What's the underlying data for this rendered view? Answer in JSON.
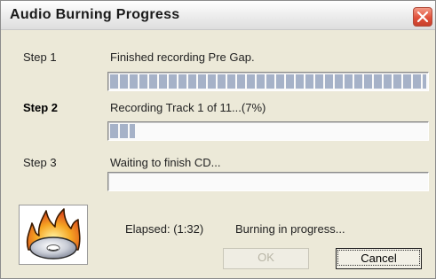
{
  "window": {
    "title": "Audio Burning Progress"
  },
  "steps": [
    {
      "label": "Step 1",
      "status": "Finished recording Pre Gap.",
      "progress": 1.0
    },
    {
      "label": "Step 2",
      "status": "Recording Track 1 of 11...(7%)",
      "progress": 0.08
    },
    {
      "label": "Step 3",
      "status": "Waiting to finish CD...",
      "progress": 0.0
    }
  ],
  "footer": {
    "elapsed": "Elapsed: (1:32)",
    "message": "Burning in progress...",
    "ok_label": "OK",
    "cancel_label": "Cancel"
  },
  "icons": {
    "close": "close-icon",
    "burn": "burning-cd-icon"
  },
  "colors": {
    "progress_fill": "#a6b2c8",
    "close_button": "#e0503a"
  }
}
